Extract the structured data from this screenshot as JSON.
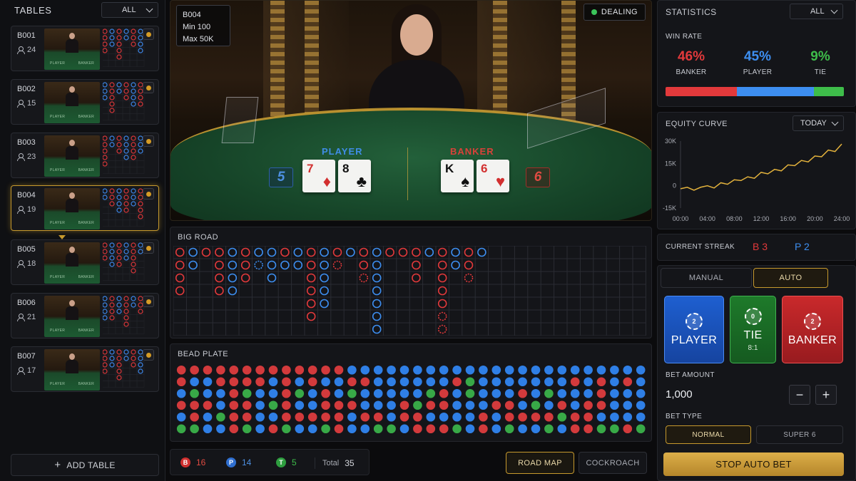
{
  "tables_panel": {
    "title": "TABLES",
    "filter": "ALL",
    "add_label": "ADD TABLE",
    "tables": [
      {
        "id": "B001",
        "players": "24"
      },
      {
        "id": "B002",
        "players": "15"
      },
      {
        "id": "B003",
        "players": "23"
      },
      {
        "id": "B004",
        "players": "19",
        "selected": true
      },
      {
        "id": "B005",
        "players": "18"
      },
      {
        "id": "B006",
        "players": "21"
      },
      {
        "id": "B007",
        "players": "17"
      }
    ],
    "thumb_left": "PLAYER",
    "thumb_right": "BANKER"
  },
  "video": {
    "table_id": "B004",
    "min": "Min 100",
    "max": "Max 50K",
    "status": "DEALING",
    "player_label": "PLAYER",
    "banker_label": "BANKER",
    "player_score": "5",
    "banker_score": "6",
    "player_cards": [
      {
        "rank": "7",
        "suit": "♦",
        "color": "#d22f2f"
      },
      {
        "rank": "8",
        "suit": "♣",
        "color": "#111111"
      }
    ],
    "banker_cards": [
      {
        "rank": "K",
        "suit": "♠",
        "color": "#111111"
      },
      {
        "rank": "6",
        "suit": "♥",
        "color": "#d22f2f"
      }
    ]
  },
  "big_road": {
    "title": "BIG ROAD",
    "columns": [
      [
        "B",
        "B",
        "B",
        "B"
      ],
      [
        "P",
        "P"
      ],
      [
        "B"
      ],
      [
        "B",
        "B",
        "B",
        "B"
      ],
      [
        "P",
        "P",
        "P",
        "P"
      ],
      [
        "B",
        "B",
        "B"
      ],
      [
        "P",
        "p"
      ],
      [
        "P",
        "P",
        "P"
      ],
      [
        "B",
        "P"
      ],
      [
        "P",
        "P"
      ],
      [
        "B",
        "B",
        "B",
        "B",
        "B",
        "B"
      ],
      [
        "P",
        "P",
        "P",
        "P",
        "P"
      ],
      [
        "B",
        "b"
      ],
      [
        "P"
      ],
      [
        "B",
        "B",
        "b"
      ],
      [
        "P",
        "P",
        "P",
        "P",
        "P",
        "P",
        "P"
      ],
      [
        "B"
      ],
      [
        "B"
      ],
      [
        "B",
        "B",
        "B"
      ],
      [
        "P"
      ],
      [
        "B",
        "B",
        "B",
        "B",
        "B",
        "b",
        "b"
      ],
      [
        "P",
        "P"
      ],
      [
        "B",
        "B",
        "b"
      ],
      [
        "P"
      ]
    ]
  },
  "bead_plate": {
    "title": "BEAD PLATE",
    "rows": [
      "BBBBBBBBBBBBBPPPPPPPPPPPPPPPPPPPPPPPPPPGPPPP",
      "BPPBBBBPBPBPPBBPPPPPPBGPPPPPPPBPBPBPPPPPPP",
      "PGPPBGPPBGPBPGPPPPPGBPGPPPBPGPPPBPPPGPBBGB",
      "BBBPBBPGBPPBBBPPPBGBBPPPBBPGPBPBBPPPBPPBPP",
      "PBPGBBPPBBBBBPBBPBBPPPPBPBBBBGBBPPPPPBBBBB",
      "GGPPBGPBGPPGBPPGGPBBBGPBPGPPGPBBGGBGBPBPGG"
    ]
  },
  "summary": {
    "banker_letter": "B",
    "banker_count": "16",
    "player_letter": "P",
    "player_count": "14",
    "tie_letter": "T",
    "tie_count": "5",
    "total_label": "Total",
    "total_count": "35"
  },
  "view_tabs": {
    "road_map": "ROAD MAP",
    "cockroach": "COCKROACH"
  },
  "statistics": {
    "title": "STATISTICS",
    "filter": "ALL",
    "win_rate_label": "WIN RATE",
    "banker_pct": "46%",
    "player_pct": "45%",
    "tie_pct": "9%",
    "banker_label": "BANKER",
    "player_label": "PLAYER",
    "tie_label": "TIE",
    "banker_share": 0.4,
    "player_share": 0.43,
    "tie_share": 0.17,
    "colors": {
      "banker": "#e2393b",
      "player": "#3d8ef0",
      "tie": "#3ebd4a"
    }
  },
  "equity": {
    "title": "EQUITY CURVE",
    "filter": "TODAY",
    "y_ticks": [
      "30K",
      "15K",
      "0",
      "-15K"
    ],
    "x_ticks": [
      "00:00",
      "04:00",
      "08:00",
      "12:00",
      "16:00",
      "20:00",
      "24:00"
    ]
  },
  "chart_data": {
    "type": "line",
    "title": "EQUITY CURVE",
    "ylim": [
      -15000,
      30000
    ],
    "x": [
      0,
      1,
      2,
      3,
      4,
      5,
      6,
      7,
      8,
      9,
      10,
      11,
      12,
      13,
      14,
      15,
      16,
      17,
      18,
      19,
      20,
      21,
      22,
      23,
      24
    ],
    "series": [
      {
        "values": [
          -2000,
          -1000,
          -3000,
          -1000,
          0,
          -1500,
          2000,
          1000,
          4000,
          3500,
          6000,
          5000,
          9000,
          8000,
          11000,
          10000,
          14000,
          13500,
          17000,
          16000,
          20000,
          19500,
          24000,
          23000,
          28000
        ]
      }
    ]
  },
  "streak": {
    "label": "CURRENT STREAK",
    "banker": "B 3",
    "player": "P 2"
  },
  "betting": {
    "mode_manual": "MANUAL",
    "mode_auto": "AUTO",
    "player_btn": "PLAYER",
    "player_chip": "2",
    "tie_btn": "TIE",
    "tie_chip": "0",
    "tie_odds": "8:1",
    "banker_btn": "BANKER",
    "banker_chip": "2",
    "amount_label": "BET AMOUNT",
    "amount": "1,000",
    "minus": "−",
    "plus": "+",
    "type_label": "BET TYPE",
    "type_normal": "NORMAL",
    "type_super6": "SUPER 6",
    "stop_label": "STOP AUTO BET"
  }
}
